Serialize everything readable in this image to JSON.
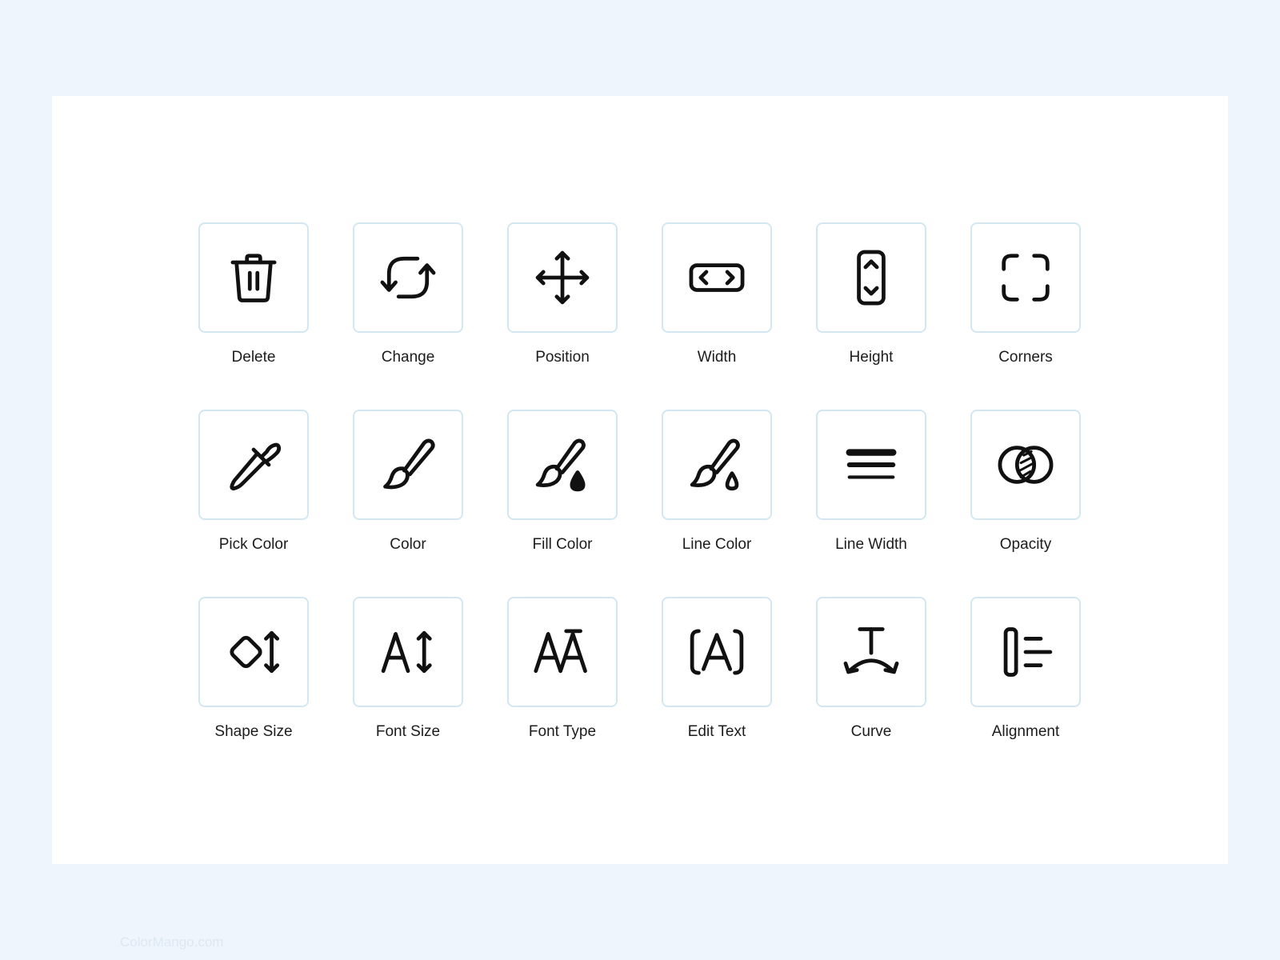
{
  "colors": {
    "page_background": "#eef5fd",
    "card_background": "#ffffff",
    "tile_border": "#d4e7f1",
    "icon_stroke": "#111111"
  },
  "tools": [
    {
      "label": "Delete",
      "icon": "trash-icon"
    },
    {
      "label": "Change",
      "icon": "swap-arrows-icon"
    },
    {
      "label": "Position",
      "icon": "move-arrows-icon"
    },
    {
      "label": "Width",
      "icon": "width-icon"
    },
    {
      "label": "Height",
      "icon": "height-icon"
    },
    {
      "label": "Corners",
      "icon": "corners-icon"
    },
    {
      "label": "Pick Color",
      "icon": "eyedropper-icon"
    },
    {
      "label": "Color",
      "icon": "brush-icon"
    },
    {
      "label": "Fill Color",
      "icon": "brush-fill-drop-icon"
    },
    {
      "label": "Line Color",
      "icon": "brush-outline-drop-icon"
    },
    {
      "label": "Line Width",
      "icon": "line-width-icon"
    },
    {
      "label": "Opacity",
      "icon": "overlap-circles-icon"
    },
    {
      "label": "Shape Size",
      "icon": "diamond-resize-icon"
    },
    {
      "label": "Font Size",
      "icon": "font-size-icon"
    },
    {
      "label": "Font Type",
      "icon": "font-type-icon"
    },
    {
      "label": "Edit Text",
      "icon": "edit-text-icon"
    },
    {
      "label": "Curve",
      "icon": "curve-text-icon"
    },
    {
      "label": "Alignment",
      "icon": "align-left-icon"
    }
  ],
  "watermark": "ColorMango.com"
}
